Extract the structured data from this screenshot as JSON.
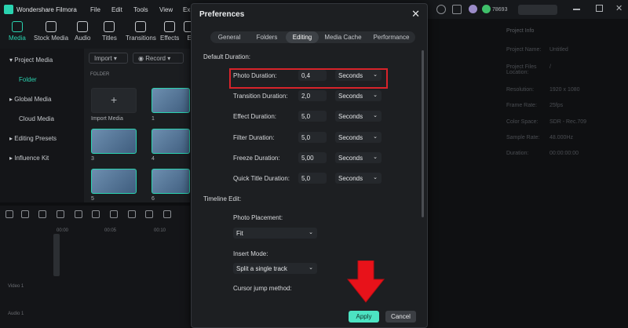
{
  "app": {
    "name": "Wondershare Filmora",
    "menu": [
      "File",
      "Edit",
      "Tools",
      "View",
      "Ex"
    ],
    "credits": "78693"
  },
  "toolbar": {
    "tools": [
      "Media",
      "Stock Media",
      "Audio",
      "Titles",
      "Transitions",
      "Effects",
      "E"
    ]
  },
  "left_panel": {
    "items": [
      "Project Media",
      "Folder",
      "Global Media",
      "Cloud Media",
      "Editing Presets",
      "Influence Kit"
    ]
  },
  "media": {
    "import_label": "Import",
    "record_label": "Record",
    "folder_label": "FOLDER",
    "import_media_label": "Import Media",
    "thumb_labels": [
      "1",
      "3",
      "4",
      "5",
      "6"
    ]
  },
  "right_panel": {
    "header": "Project Info",
    "rows": [
      {
        "label": "Project Name:",
        "value": "Untitled"
      },
      {
        "label": "Project Files Location:",
        "value": "/"
      },
      {
        "label": "Resolution:",
        "value": "1920 x 1080"
      },
      {
        "label": "Frame Rate:",
        "value": "25fps"
      },
      {
        "label": "Color Space:",
        "value": "SDR - Rec.709"
      },
      {
        "label": "Sample Rate:",
        "value": "48.000Hz"
      },
      {
        "label": "Duration:",
        "value": "00:00:00:00"
      }
    ]
  },
  "timeline": {
    "ruler": [
      "00:00",
      "00:05",
      "00:10"
    ],
    "tracks": [
      "Video 1",
      "Audio 1"
    ]
  },
  "dialog": {
    "title": "Preferences",
    "tabs": [
      "General",
      "Folders",
      "Editing",
      "Media Cache",
      "Performance"
    ],
    "active_tab": "Editing",
    "default_duration_label": "Default Duration:",
    "durations": [
      {
        "label": "Photo Duration:",
        "value": "0,4",
        "unit": "Seconds"
      },
      {
        "label": "Transition Duration:",
        "value": "2,0",
        "unit": "Seconds"
      },
      {
        "label": "Effect Duration:",
        "value": "5,0",
        "unit": "Seconds"
      },
      {
        "label": "Filter Duration:",
        "value": "5,0",
        "unit": "Seconds"
      },
      {
        "label": "Freeze Duration:",
        "value": "5,00",
        "unit": "Seconds"
      },
      {
        "label": "Quick Title Duration:",
        "value": "5,0",
        "unit": "Seconds"
      }
    ],
    "timeline_edit_label": "Timeline Edit:",
    "photo_placement_label": "Photo Placement:",
    "photo_placement_value": "Fit",
    "insert_mode_label": "Insert Mode:",
    "insert_mode_value": "Split a single track",
    "cursor_jump_label": "Cursor jump method:",
    "apply_label": "Apply",
    "cancel_label": "Cancel"
  },
  "colors": {
    "accent": "#2ad3b0",
    "apply": "#4ce3c2",
    "highlight": "#d8232a"
  }
}
